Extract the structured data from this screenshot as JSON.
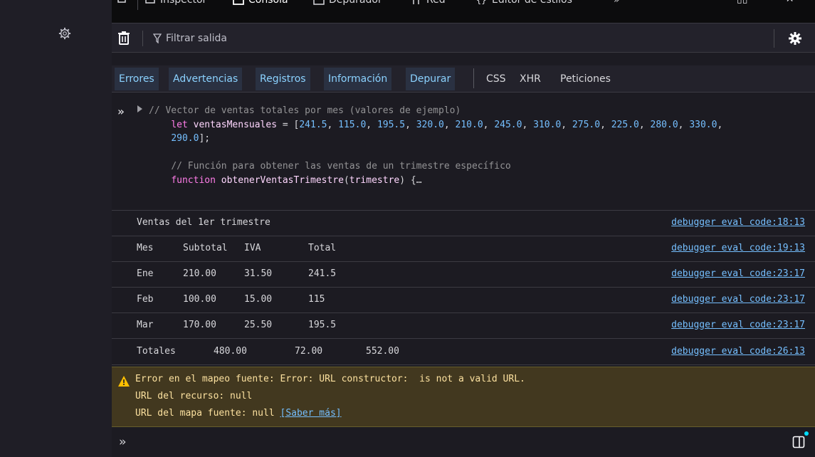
{
  "toptabs": [
    {
      "label": "Inspector",
      "selected": false,
      "icon": "inspector-icon"
    },
    {
      "label": "Consola",
      "selected": true,
      "icon": "console-icon"
    },
    {
      "label": "Depurador",
      "selected": false,
      "icon": "debugger-icon"
    },
    {
      "label": "Red",
      "selected": false,
      "icon": "network-icon"
    },
    {
      "label": "Editor de estilos",
      "selected": false,
      "icon": "style-editor-icon"
    }
  ],
  "toolbar": {
    "filter_placeholder": "Filtrar salida"
  },
  "levels": [
    "Errores",
    "Advertencias",
    "Registros",
    "Información",
    "Depurar"
  ],
  "request_filters": [
    "CSS",
    "XHR",
    "Peticiones"
  ],
  "code_lines": {
    "l1": "// Vector de ventas totales por mes (valores de ejemplo)",
    "l2_kw": "let",
    "l2_var": "ventasMensuales",
    "l2_values": [
      "241.5",
      "115.0",
      "195.5",
      "320.0",
      "210.0",
      "245.0",
      "310.0",
      "275.0",
      "225.0",
      "280.0",
      "330.0",
      "290.0"
    ],
    "l4": "// Función para obtener las ventas de un trimestre específico",
    "l5_kw": "function",
    "l5_fn": "obtenerVentasTrimestre",
    "l5_param": "trimestre",
    "l5_tail": ") {…"
  },
  "logs": [
    {
      "cells": [
        "Ventas del 1er trimestre"
      ],
      "source": "debugger eval code:18:13"
    },
    {
      "cells": [
        "Mes",
        "Subtotal",
        "IVA",
        "Total"
      ],
      "source": "debugger eval code:19:13"
    },
    {
      "cells": [
        "Ene",
        "210.00",
        "31.50",
        "241.5"
      ],
      "source": "debugger eval code:23:17"
    },
    {
      "cells": [
        "Feb",
        "100.00",
        "15.00",
        "115"
      ],
      "source": "debugger eval code:23:17"
    },
    {
      "cells": [
        "Mar",
        "170.00",
        "25.50",
        "195.5"
      ],
      "source": "debugger eval code:23:17"
    },
    {
      "cells": [
        "Totales",
        "480.00",
        "72.00",
        "552.00"
      ],
      "source": "debugger eval code:26:13"
    }
  ],
  "warning": {
    "line1": "Error en el mapeo fuente: Error: URL constructor:  is not a valid URL.",
    "line2": "URL del recurso: null",
    "line3_prefix": "URL del mapa fuente: null ",
    "link": "[Saber más]"
  },
  "colors": {
    "accent": "#75bfff",
    "warning_bg": "#42381f",
    "warning_text": "#fce19f"
  }
}
